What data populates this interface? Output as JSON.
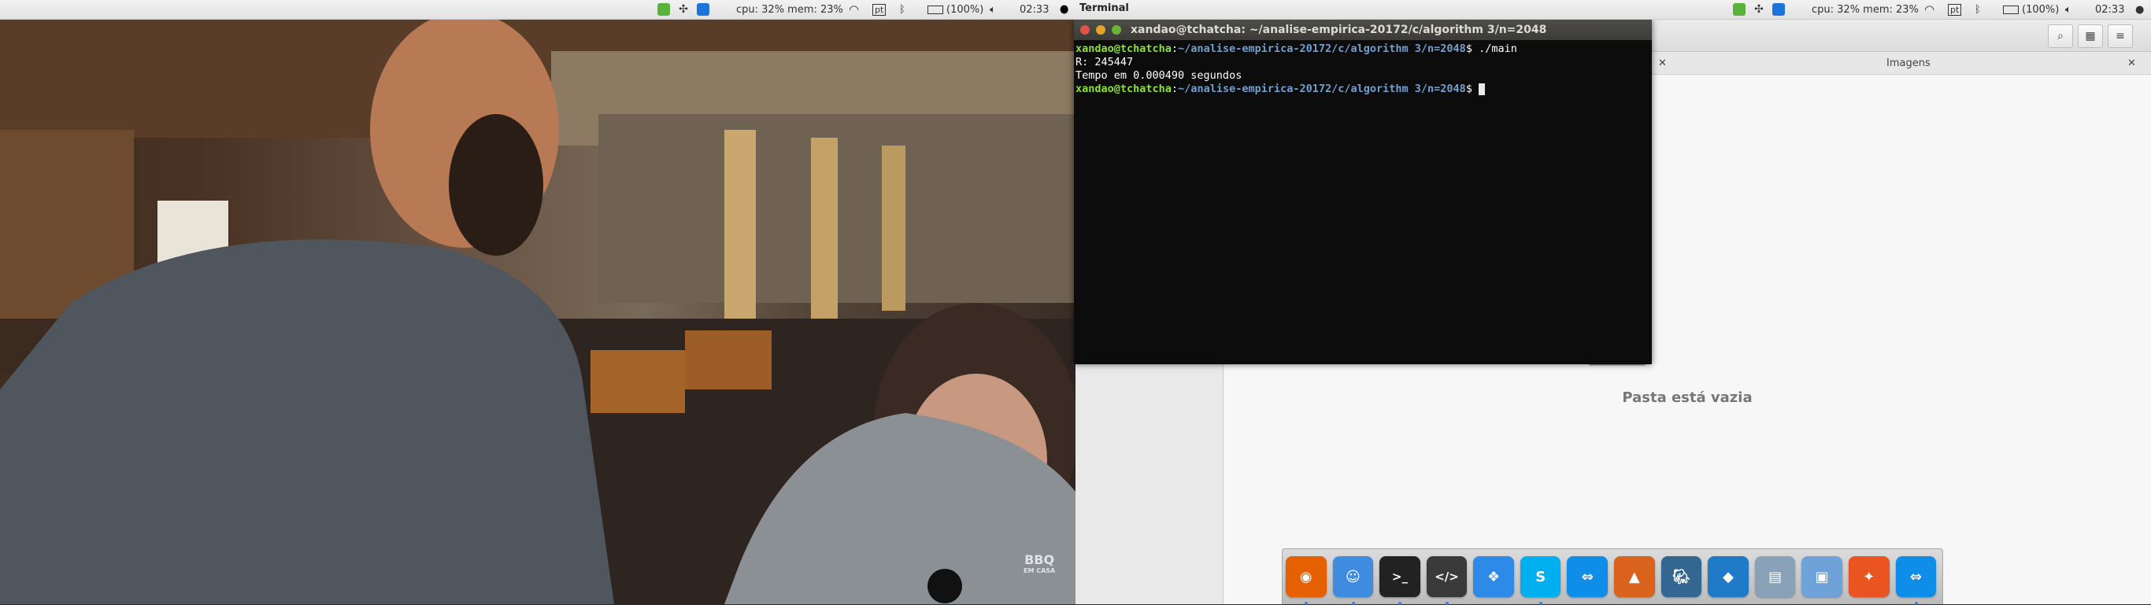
{
  "top_panel": {
    "cpu_mem": "cpu: 32% mem: 23%",
    "keyboard_layout": "pt",
    "battery": "(100%)",
    "clock": "02:33",
    "active_app": "Terminal"
  },
  "terminal": {
    "title": "xandao@tchatcha: ~/analise-empirica-20172/c/algorithm 3/n=2048",
    "user_host": "xandao@tchatcha",
    "path": "~/analise-empirica-20172/c/algorithm 3/n=2048",
    "line1_cmd": "$ ./main",
    "line2": "R: 245447",
    "line3": "Tempo em 0.000490 segundos",
    "line4_cmd": "$ "
  },
  "video": {
    "watermark_line1": "BBQ",
    "watermark_line2": "EM CASA"
  },
  "file_manager": {
    "tab_title": "Imagens",
    "empty_label": "Pasta está vazia"
  },
  "dock": {
    "items": [
      {
        "icon": "firefox-icon",
        "color": "#e66000"
      },
      {
        "icon": "finder-icon",
        "color": "#3f8be0"
      },
      {
        "icon": "terminal-icon",
        "color": "#222222"
      },
      {
        "icon": "code-editor-icon",
        "color": "#3a3a3a"
      },
      {
        "icon": "dropbox-icon",
        "color": "#2d8ae6"
      },
      {
        "icon": "skype-icon",
        "color": "#00aff0"
      },
      {
        "icon": "teamviewer-icon",
        "color": "#0e8ee9"
      },
      {
        "icon": "matlab-icon",
        "color": "#d9621c"
      },
      {
        "icon": "postgresql-icon",
        "color": "#336791"
      },
      {
        "icon": "mysql-workbench-icon",
        "color": "#1f7bc8"
      },
      {
        "icon": "scanner-icon",
        "color": "#8aa2b8"
      },
      {
        "icon": "virtualbox-icon",
        "color": "#6fa2d8"
      },
      {
        "icon": "ubuntu-software-icon",
        "color": "#e95420"
      },
      {
        "icon": "teamviewer-icon-2",
        "color": "#0e8ee9"
      }
    ]
  }
}
